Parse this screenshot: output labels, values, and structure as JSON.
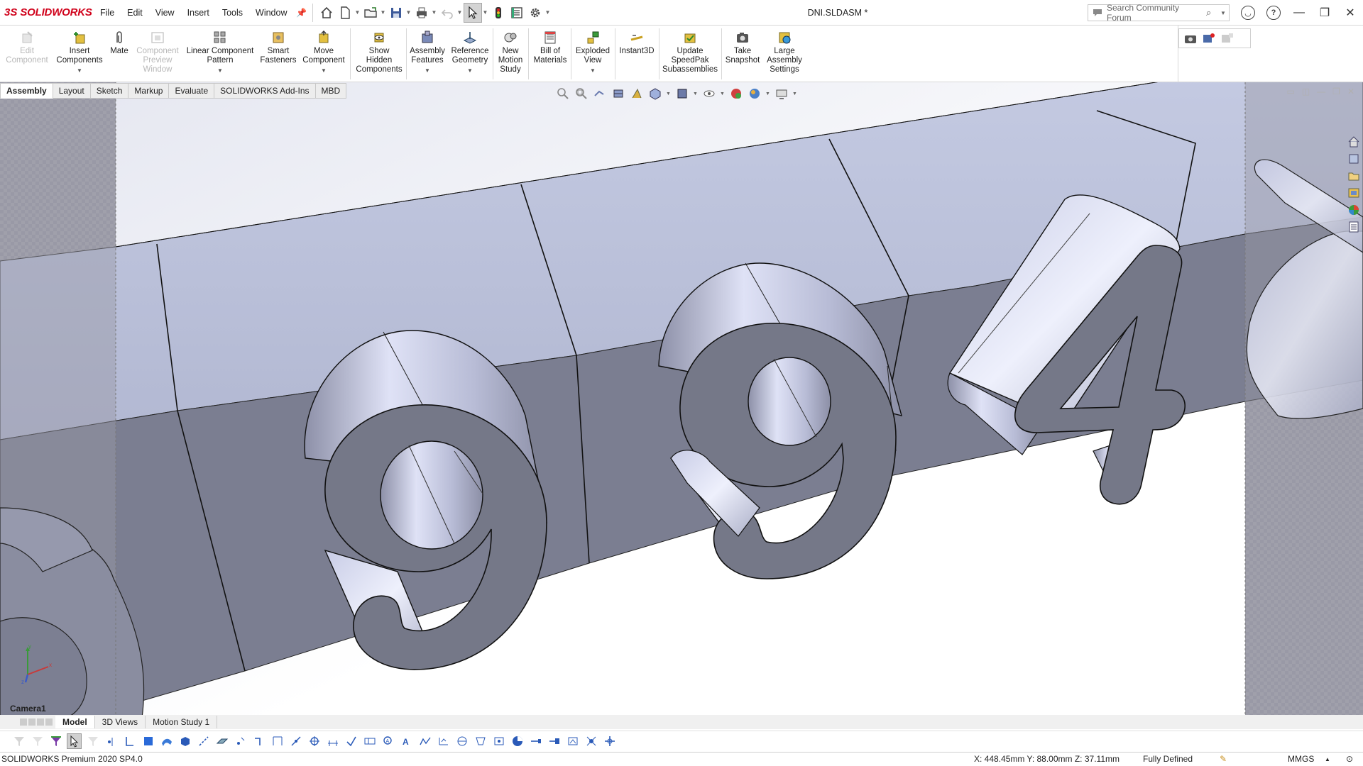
{
  "app": {
    "brand_ds": "3S",
    "brand_name": "SOLIDWORKS",
    "document_title": "DNI.SLDASM *"
  },
  "menu": [
    "File",
    "Edit",
    "View",
    "Insert",
    "Tools",
    "Window"
  ],
  "search": {
    "placeholder": "Search Community Forum"
  },
  "commands": [
    {
      "label": "Edit Component",
      "lines": [
        "Edit",
        "Component"
      ],
      "icon": "edit-component-icon",
      "enabled": false
    },
    {
      "label": "Insert Components",
      "lines": [
        "Insert",
        "Components"
      ],
      "icon": "insert-components-icon",
      "enabled": true
    },
    {
      "label": "Mate",
      "lines": [
        "Mate"
      ],
      "icon": "mate-icon",
      "enabled": true
    },
    {
      "label": "Component Preview Window",
      "lines": [
        "Component",
        "Preview",
        "Window"
      ],
      "icon": "component-preview-icon",
      "enabled": false
    },
    {
      "label": "Linear Component Pattern",
      "lines": [
        "Linear Component",
        "Pattern"
      ],
      "icon": "linear-pattern-icon",
      "enabled": true
    },
    {
      "label": "Smart Fasteners",
      "lines": [
        "Smart",
        "Fasteners"
      ],
      "icon": "smart-fasteners-icon",
      "enabled": true
    },
    {
      "label": "Move Component",
      "lines": [
        "Move",
        "Component"
      ],
      "icon": "move-component-icon",
      "enabled": true
    },
    {
      "label": "Show Hidden Components",
      "lines": [
        "Show",
        "Hidden",
        "Components"
      ],
      "icon": "show-hidden-icon",
      "enabled": true
    },
    {
      "label": "Assembly Features",
      "lines": [
        "Assembly",
        "Features"
      ],
      "icon": "assembly-features-icon",
      "enabled": true
    },
    {
      "label": "Reference Geometry",
      "lines": [
        "Reference",
        "Geometry"
      ],
      "icon": "reference-geometry-icon",
      "enabled": true
    },
    {
      "label": "New Motion Study",
      "lines": [
        "New",
        "Motion",
        "Study"
      ],
      "icon": "motion-study-icon",
      "enabled": true
    },
    {
      "label": "Bill of Materials",
      "lines": [
        "Bill of",
        "Materials"
      ],
      "icon": "bom-icon",
      "enabled": true
    },
    {
      "label": "Exploded View",
      "lines": [
        "Exploded",
        "View"
      ],
      "icon": "exploded-view-icon",
      "enabled": true
    },
    {
      "label": "Instant3D",
      "lines": [
        "Instant3D"
      ],
      "icon": "instant3d-icon",
      "enabled": true
    },
    {
      "label": "Update SpeedPak Subassemblies",
      "lines": [
        "Update",
        "SpeedPak",
        "Subassemblies"
      ],
      "icon": "speedpak-icon",
      "enabled": true
    },
    {
      "label": "Take Snapshot",
      "lines": [
        "Take",
        "Snapshot"
      ],
      "icon": "snapshot-icon",
      "enabled": true
    },
    {
      "label": "Large Assembly Settings",
      "lines": [
        "Large",
        "Assembly",
        "Settings"
      ],
      "icon": "large-assembly-icon",
      "enabled": true
    }
  ],
  "command_tabs": [
    {
      "label": "Assembly",
      "active": true
    },
    {
      "label": "Layout",
      "active": false
    },
    {
      "label": "Sketch",
      "active": false
    },
    {
      "label": "Markup",
      "active": false
    },
    {
      "label": "Evaluate",
      "active": false
    },
    {
      "label": "SOLIDWORKS Add-Ins",
      "active": false
    },
    {
      "label": "MBD",
      "active": false
    }
  ],
  "viewport": {
    "camera_label": "Camera1",
    "visible_digits": [
      "9",
      "9",
      "4"
    ],
    "colors": {
      "part_top": "#b9bfd7",
      "part_front": "#7a7d90",
      "digit_face": "#757888",
      "cylinder_light": "#d8dcf2",
      "background": "#ffffff",
      "checker": "#9a9aa6"
    },
    "triad_axes": [
      "x",
      "y",
      "z"
    ]
  },
  "bottom_tabs": [
    {
      "label": "Model",
      "active": true
    },
    {
      "label": "3D Views",
      "active": false
    },
    {
      "label": "Motion Study 1",
      "active": false
    }
  ],
  "status": {
    "product": "SOLIDWORKS Premium 2020 SP4.0",
    "coordinates": "X: 448.45mm Y: 88.00mm Z: 37.11mm",
    "state": "Fully Defined",
    "units": "MMGS"
  }
}
